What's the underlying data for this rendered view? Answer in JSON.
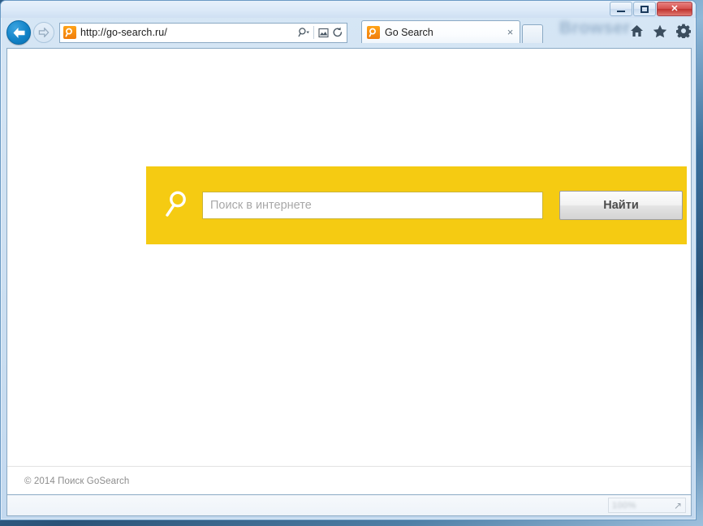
{
  "window": {
    "controls": {
      "minimize_label": "Minimize",
      "maximize_label": "Restore",
      "close_label": "✕"
    },
    "watermark_text": "Browser"
  },
  "navigation": {
    "back_label": "Back",
    "forward_label": "Forward",
    "address_value": "http://go-search.ru/",
    "address_placeholder": "http://go-search.ru/",
    "favicon_name": "go-search-favicon",
    "icons": {
      "search_dropdown": "search-dropdown-icon",
      "compatibility": "compatibility-view-icon",
      "refresh": "refresh-icon"
    }
  },
  "tabs": [
    {
      "title": "Go Search",
      "close_label": "×",
      "favicon_name": "go-search-favicon",
      "active": true
    }
  ],
  "new_tab_label": "New Tab",
  "toolbar": {
    "home_label": "Home",
    "favorites_label": "Favorites",
    "tools_label": "Tools"
  },
  "page": {
    "title": "Go Search",
    "search": {
      "placeholder": "Поиск в интернете",
      "value": "",
      "submit_label": "Найти",
      "icon_name": "magnifier-icon",
      "panel_color": "#F5CB12"
    },
    "footer": {
      "copyright": "© 2014   Поиск GoSearch"
    }
  },
  "status_bar": {
    "zoom_level": "100%",
    "resize_grip": "↗"
  },
  "colors": {
    "accent_yellow": "#F5CB12",
    "favicon_orange": "#F58A0B",
    "back_button_blue": "#1283C8",
    "close_button_red": "#C8332D"
  }
}
